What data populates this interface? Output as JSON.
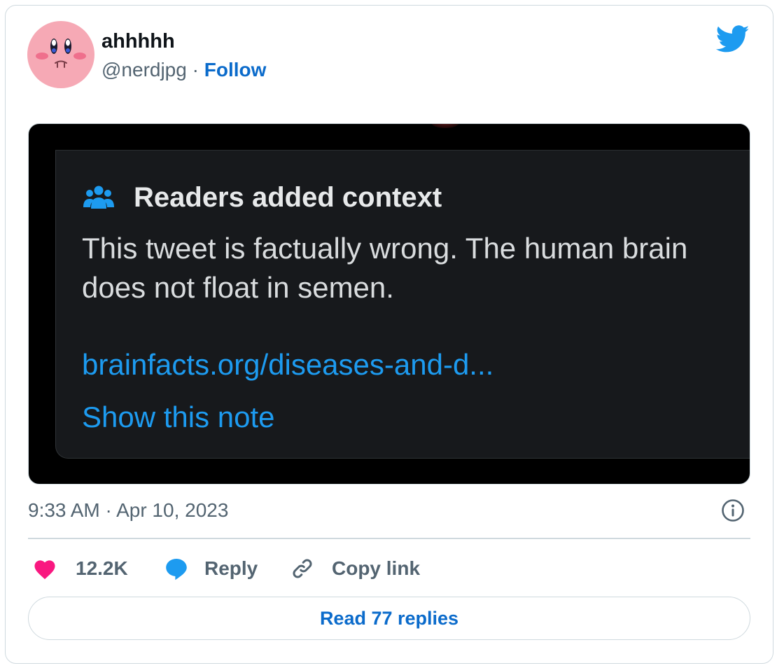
{
  "author": {
    "name": "ahhhhh",
    "handle": "@nerdjpg",
    "separator": " · ",
    "follow_label": "Follow",
    "avatar_icon": "kirby-face-avatar"
  },
  "brand": {
    "logo_icon": "twitter-bird-icon",
    "accent_color": "#1d9bf0",
    "link_color": "#0b6bcb"
  },
  "note": {
    "icon": "readers-group-icon",
    "heading": "Readers added context",
    "body": "This tweet is factually wrong. The human brain does not float in semen.",
    "link": "brainfacts.org/diseases-and-d...",
    "show_label": "Show this note"
  },
  "meta": {
    "timestamp": "9:33 AM · Apr 10, 2023",
    "info_icon": "info-icon"
  },
  "actions": {
    "likes": "12.2K",
    "reply_label": "Reply",
    "copy_label": "Copy link",
    "like_color": "#f91880"
  },
  "footer": {
    "read_replies_label": "Read 77 replies"
  }
}
